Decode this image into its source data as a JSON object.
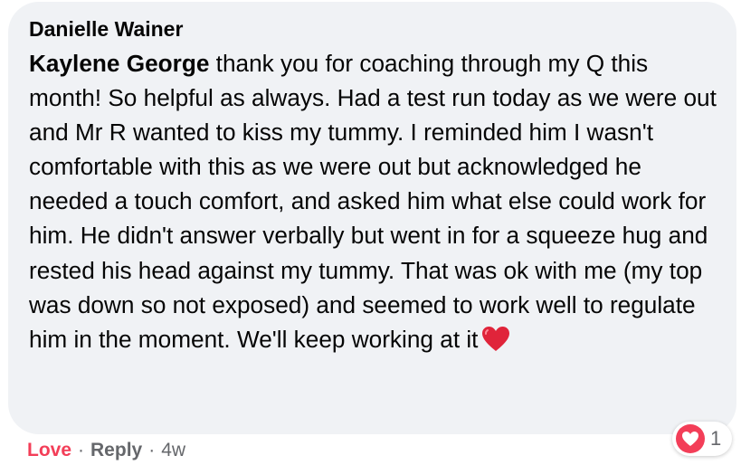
{
  "comment": {
    "author": "Danielle Wainer",
    "mention": "Kaylene George",
    "text": " thank you for coaching through my Q this month! So helpful as always. Had a test run today as we were out and Mr R wanted to kiss my tummy. I reminded him I wasn't comfortable with this as we were out but acknowledged he needed a touch comfort, and asked him what else could work for him. He didn't answer verbally but went in for a squeeze hug and rested his head against my tummy. That was ok with me (my top was down so not exposed) and seemed to work well to regulate him in the moment. We'll keep working at it",
    "trailing_emoji": "red-heart-emoji"
  },
  "reactions": {
    "type_icon": "love-heart-icon",
    "count": "1"
  },
  "actions": {
    "love_label": "Love",
    "separator": "·",
    "reply_label": "Reply",
    "timestamp": "4w"
  },
  "colors": {
    "bubble_bg": "#f0f2f5",
    "love_accent": "#f33e58",
    "secondary_text": "#65676b",
    "primary_text": "#050505"
  }
}
